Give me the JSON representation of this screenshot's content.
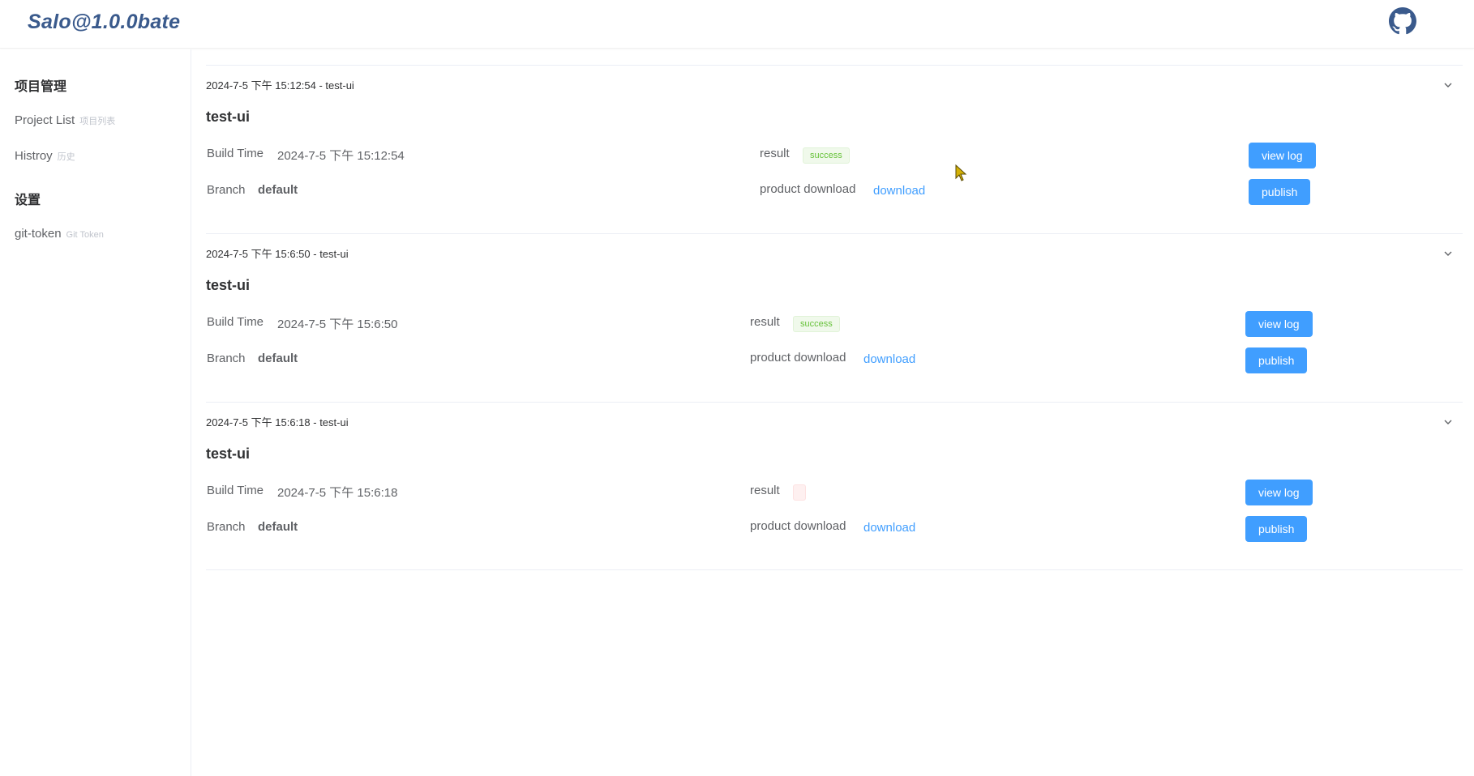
{
  "header": {
    "logo": "Salo@1.0.0bate",
    "github_icon": "github-icon"
  },
  "sidebar": {
    "group1_title": "项目管理",
    "items": [
      {
        "label": "Project List",
        "sub": "项目列表"
      },
      {
        "label": "Histroy",
        "sub": "历史"
      }
    ],
    "group2_title": "设置",
    "settings_items": [
      {
        "label": "git-token",
        "sub": "Git Token"
      }
    ]
  },
  "labels": {
    "build_time": "Build Time",
    "branch": "Branch",
    "result": "result",
    "product_download": "product download",
    "download_link": "download",
    "view_log": "view log",
    "publish": "publish"
  },
  "records": [
    {
      "header": "2024-7-5 下午 15:12:54 - test-ui",
      "title": "test-ui",
      "build_time": "2024-7-5 下午 15:12:54",
      "branch": "default",
      "result": "success"
    },
    {
      "header": "2024-7-5 下午 15:6:50 - test-ui",
      "title": "test-ui",
      "build_time": "2024-7-5 下午 15:6:50",
      "branch": "default",
      "result": "success"
    },
    {
      "header": "2024-7-5 下午 15:6:18 - test-ui",
      "title": "test-ui",
      "build_time": "2024-7-5 下午 15:6:18",
      "branch": "default",
      "result": ""
    }
  ],
  "colors": {
    "primary": "#409eff",
    "success_text": "#67c23a",
    "logo": "#3a5a8c"
  }
}
